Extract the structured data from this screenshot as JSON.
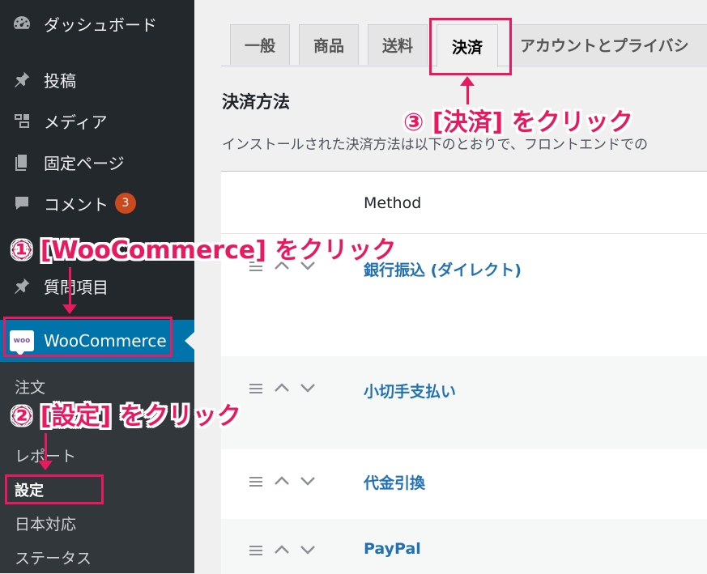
{
  "sidebar": {
    "items": [
      {
        "label": "ダッシュボード",
        "icon": "dashboard-icon"
      },
      {
        "label": "投稿",
        "icon": "pin-icon"
      },
      {
        "label": "メディア",
        "icon": "media-icon"
      },
      {
        "label": "固定ページ",
        "icon": "page-icon"
      },
      {
        "label": "コメント",
        "icon": "comment-icon",
        "badge": "3"
      },
      {
        "label": "質問項目",
        "icon": "pin-icon"
      }
    ],
    "woocommerce": {
      "label": "WooCommerce",
      "logo_text": "woo"
    },
    "submenu": [
      {
        "label": "注文"
      },
      {
        "label": "レポート"
      },
      {
        "label": "設定",
        "current": true
      },
      {
        "label": "日本対応"
      },
      {
        "label": "ステータス"
      }
    ]
  },
  "tabs": [
    {
      "label": "一般"
    },
    {
      "label": "商品"
    },
    {
      "label": "送料"
    },
    {
      "label": "決済",
      "active": true
    },
    {
      "label": "アカウントとプライバシ"
    }
  ],
  "section": {
    "title": "決済方法",
    "description": "インストールされた決済方法は以下のとおりで、フロントエンドでの"
  },
  "table": {
    "header": {
      "method": "Method"
    },
    "rows": [
      {
        "name": "銀行振込 (ダイレクト)"
      },
      {
        "name": "小切手支払い"
      },
      {
        "name": "代金引換"
      },
      {
        "name": "PayPal"
      }
    ]
  },
  "annotations": {
    "step1": "① [WooCommerce] をクリック",
    "step2": "② [設定] をクリック",
    "step3": "③ [決済] をクリック"
  },
  "colors": {
    "sidebar_bg": "#23282d",
    "submenu_bg": "#32373c",
    "accent_blue": "#0073aa",
    "link_blue": "#2271b1",
    "annotation_pink": "#e8195f",
    "badge_orange": "#ca4a1f"
  }
}
